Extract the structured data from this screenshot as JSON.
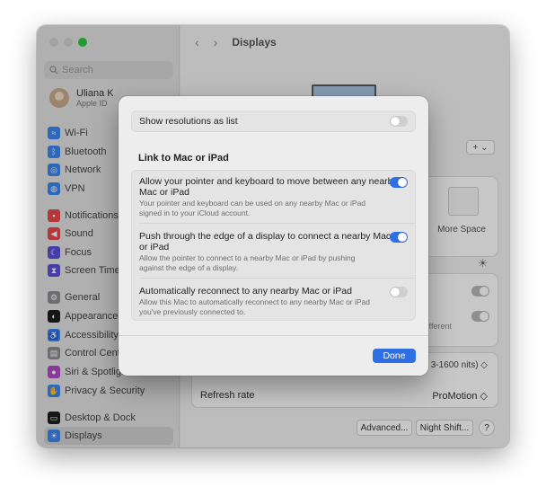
{
  "sidebar": {
    "search_placeholder": "Search",
    "user": {
      "name": "Uliana K",
      "subtitle": "Apple ID"
    },
    "items": [
      {
        "label": "Wi-Fi",
        "icon": "wifi-icon",
        "color": "#3a86f0"
      },
      {
        "label": "Bluetooth",
        "icon": "bluetooth-icon",
        "color": "#3a86f0"
      },
      {
        "label": "Network",
        "icon": "globe-icon",
        "color": "#3a86f0"
      },
      {
        "label": "VPN",
        "icon": "vpn-icon",
        "color": "#3a86f0"
      },
      {
        "label": "Notifications",
        "icon": "bell-icon",
        "color": "#e5484d"
      },
      {
        "label": "Sound",
        "icon": "speaker-icon",
        "color": "#e5484d"
      },
      {
        "label": "Focus",
        "icon": "moon-icon",
        "color": "#5b4fd6"
      },
      {
        "label": "Screen Time",
        "icon": "hourglass-icon",
        "color": "#5b4fd6"
      },
      {
        "label": "General",
        "icon": "gear-icon",
        "color": "#8e8e93"
      },
      {
        "label": "Appearance",
        "icon": "appearance-icon",
        "color": "#1d1d1f"
      },
      {
        "label": "Accessibility",
        "icon": "accessibility-icon",
        "color": "#3a86f0"
      },
      {
        "label": "Control Centre",
        "icon": "control-centre-icon",
        "color": "#8e8e93"
      },
      {
        "label": "Siri & Spotlight",
        "icon": "siri-icon",
        "color": "#b04ac6"
      },
      {
        "label": "Privacy & Security",
        "icon": "hand-icon",
        "color": "#3a86f0"
      },
      {
        "label": "Desktop & Dock",
        "icon": "dock-icon",
        "color": "#1d1d1f"
      },
      {
        "label": "Displays",
        "icon": "sun-icon",
        "color": "#3a86f0"
      }
    ]
  },
  "main": {
    "title": "Displays",
    "plus_label": "+ ⌄",
    "more_space": "More Space",
    "different_text": "fferent",
    "nits_text": "3-1600 nits) ◇",
    "refresh_label": "Refresh rate",
    "refresh_value": "ProMotion ◇",
    "advanced_label": "Advanced...",
    "night_shift_label": "Night Shift...",
    "help_label": "?"
  },
  "sheet": {
    "show_resolutions_label": "Show resolutions as list",
    "section_title": "Link to Mac or iPad",
    "rows": [
      {
        "label_1": "Allow your pointer and keyboard to move between any nearby",
        "label_2": "Mac or iPad",
        "desc_1": "Your pointer and keyboard can be used on any nearby Mac or iPad",
        "desc_2": "signed in to your iCloud account.",
        "on": true
      },
      {
        "label_1": "Push through the edge of a display to connect a nearby Mac",
        "label_2": "or iPad",
        "desc_1": "Allow the pointer to connect to a nearby Mac or iPad by pushing",
        "desc_2": "against the edge of a display.",
        "on": true
      },
      {
        "label_1": "Automatically reconnect to any nearby Mac or iPad",
        "desc_1": "Allow this Mac to automatically reconnect to any nearby Mac or iPad",
        "desc_2": "you've previously connected to.",
        "on": false
      }
    ],
    "done_label": "Done"
  },
  "colors": {
    "accent": "#2f6fe4",
    "window_bg": "#ececec"
  }
}
